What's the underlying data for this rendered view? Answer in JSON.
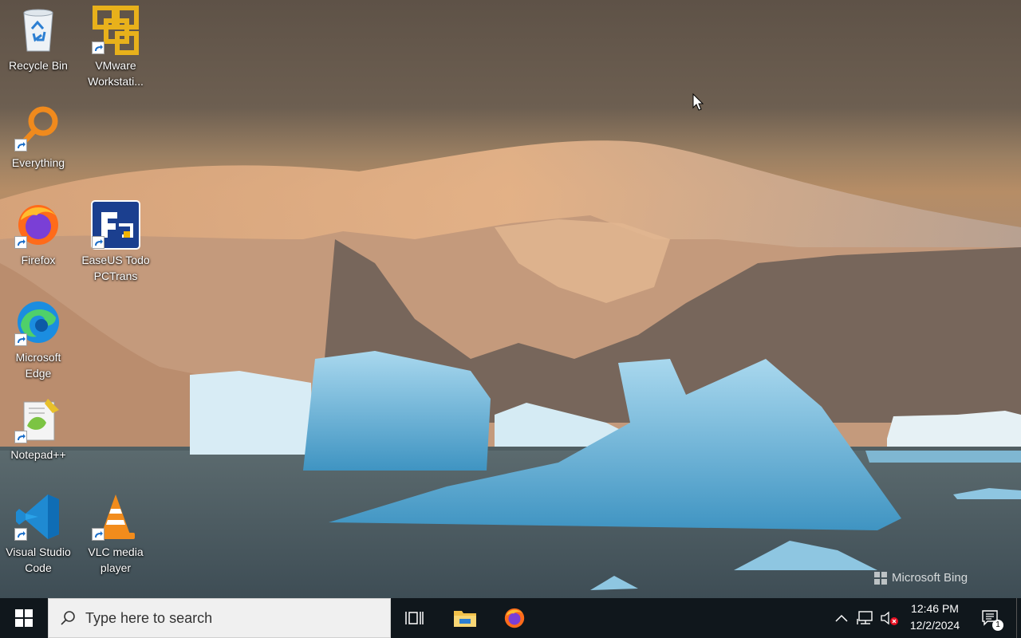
{
  "desktop": {
    "icons": [
      {
        "label": "Recycle Bin",
        "icon": "recycle-bin-icon"
      },
      {
        "label": "VMware Workstati...",
        "icon": "vmware-icon"
      },
      {
        "label": "Everything",
        "icon": "everything-search-icon"
      },
      {
        "label": "Firefox",
        "icon": "firefox-icon"
      },
      {
        "label": "EaseUS Todo PCTrans",
        "icon": "easeus-pctrans-icon"
      },
      {
        "label": "Microsoft Edge",
        "icon": "edge-icon"
      },
      {
        "label": "Notepad++",
        "icon": "notepadpp-icon"
      },
      {
        "label": "Visual Studio Code",
        "icon": "vscode-icon"
      },
      {
        "label": "VLC media player",
        "icon": "vlc-icon"
      }
    ],
    "watermark": "Microsoft Bing"
  },
  "taskbar": {
    "search_placeholder": "Type here to search",
    "pinned": [
      {
        "name": "Task View",
        "icon": "task-view-icon"
      },
      {
        "name": "File Explorer",
        "icon": "file-explorer-icon"
      },
      {
        "name": "Firefox",
        "icon": "firefox-icon"
      }
    ],
    "tray": {
      "time": "12:46 PM",
      "date": "12/2/2024",
      "notification_count": "1"
    }
  },
  "colors": {
    "taskbar_bg": "#10171c",
    "search_bg": "#f0f0f0",
    "start_blue": "#ffffff"
  }
}
